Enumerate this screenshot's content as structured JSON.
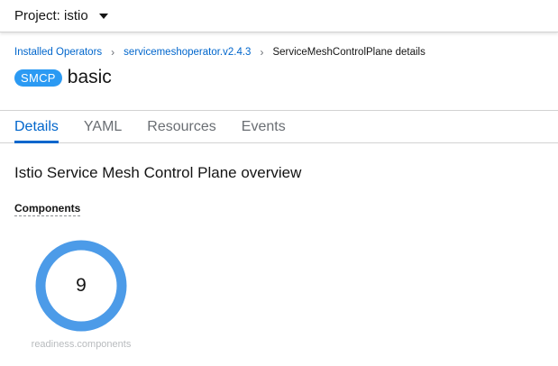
{
  "project_bar": {
    "label": "Project: istio"
  },
  "breadcrumb": {
    "items": [
      "Installed Operators",
      "servicemeshoperator.v2.4.3",
      "ServiceMeshControlPlane details"
    ]
  },
  "resource": {
    "badge": "SMCP",
    "name": "basic",
    "badge_color": "#2b9af3"
  },
  "tabs": {
    "items": [
      "Details",
      "YAML",
      "Resources",
      "Events"
    ],
    "active": "Details"
  },
  "overview": {
    "title": "Istio Service Mesh Control Plane overview",
    "components_label": "Components",
    "donut": {
      "value": "9",
      "caption": "readiness.components",
      "color": "#4c9be8"
    }
  },
  "icons": {
    "project_caret": "caret-down-icon",
    "breadcrumb_separator": "chevron-right-icon"
  },
  "colors": {
    "link": "#0066cc",
    "active_tab": "#0066cc"
  }
}
